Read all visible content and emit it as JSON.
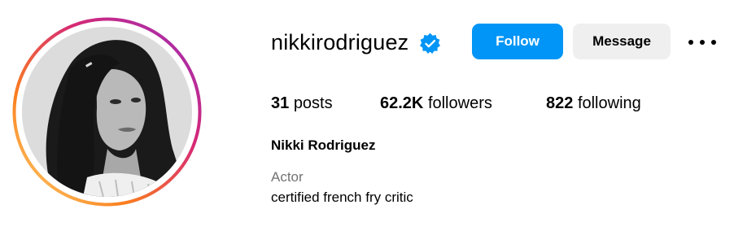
{
  "profile": {
    "username": "nikkirodriguez",
    "full_name": "Nikki Rodriguez",
    "category": "Actor",
    "bio": "certified french fry critic",
    "verified_icon": "verified-badge-icon",
    "avatar_icon": "profile-photo"
  },
  "actions": {
    "follow_label": "Follow",
    "message_label": "Message",
    "more_icon": "more-options-icon"
  },
  "stats": {
    "posts_count": "31",
    "posts_label": "posts",
    "followers_count": "62.2K",
    "followers_label": "followers",
    "following_count": "822",
    "following_label": "following"
  },
  "colors": {
    "follow_button": "#0095f6",
    "message_button": "#efefef",
    "verified_badge": "#0095f6",
    "muted_text": "#737373",
    "story_ring_gradient": [
      "#feda75",
      "#fa7e1e",
      "#d62976",
      "#962fbf"
    ]
  }
}
